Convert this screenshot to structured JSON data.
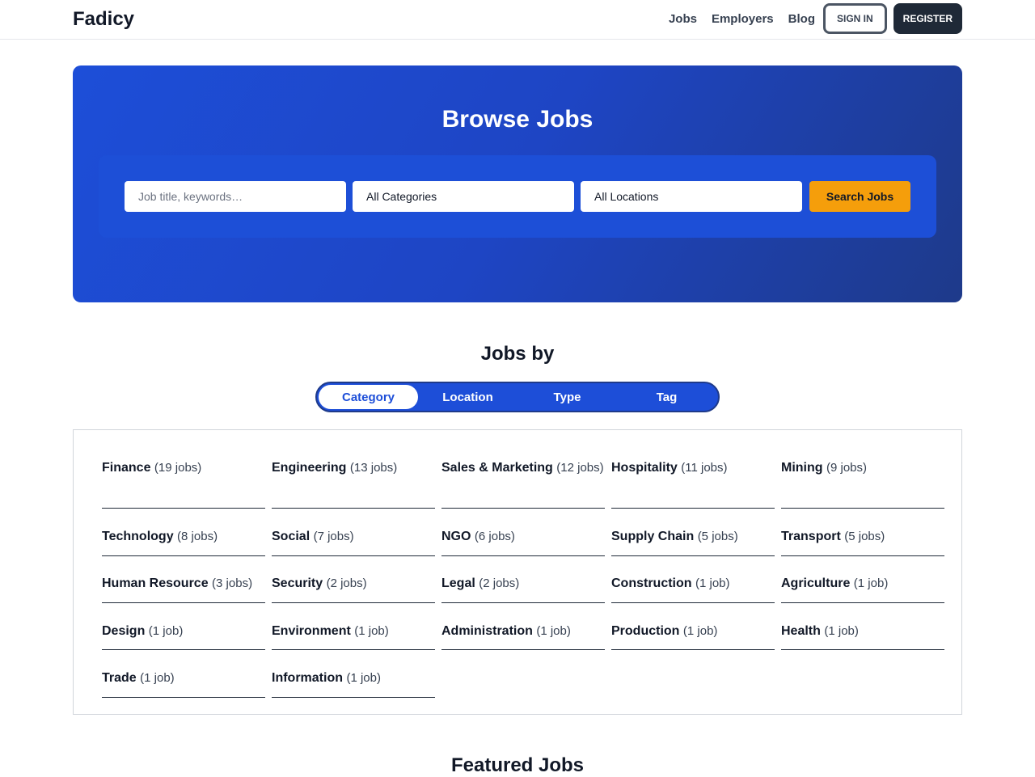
{
  "header": {
    "brand": "Fadicy",
    "nav": [
      "Jobs",
      "Employers",
      "Blog"
    ],
    "sign_in": "SIGN IN",
    "register": "REGISTER"
  },
  "hero": {
    "title": "Browse Jobs",
    "search_placeholder": "Job title, keywords…",
    "category_select": "All Categories",
    "location_select": "All Locations",
    "search_button": "Search Jobs"
  },
  "jobs_by": {
    "title": "Jobs by",
    "tabs": [
      "Category",
      "Location",
      "Type",
      "Tag"
    ],
    "active_tab": "Category",
    "categories": [
      {
        "name": "Finance",
        "count": "(19 jobs)"
      },
      {
        "name": "Engineering",
        "count": "(13 jobs)"
      },
      {
        "name": "Sales & Marketing",
        "count": "(12 jobs)"
      },
      {
        "name": "Hospitality",
        "count": "(11 jobs)"
      },
      {
        "name": "Mining",
        "count": "(9 jobs)"
      },
      {
        "name": "Technology",
        "count": "(8 jobs)"
      },
      {
        "name": "Social",
        "count": "(7 jobs)"
      },
      {
        "name": "NGO",
        "count": "(6 jobs)"
      },
      {
        "name": "Supply Chain",
        "count": "(5 jobs)"
      },
      {
        "name": "Transport",
        "count": "(5 jobs)"
      },
      {
        "name": "Human Resource",
        "count": "(3 jobs)"
      },
      {
        "name": "Security",
        "count": "(2 jobs)"
      },
      {
        "name": "Legal",
        "count": "(2 jobs)"
      },
      {
        "name": "Construction",
        "count": "(1 job)"
      },
      {
        "name": "Agriculture",
        "count": "(1 job)"
      },
      {
        "name": "Design",
        "count": "(1 job)"
      },
      {
        "name": "Environment",
        "count": "(1 job)"
      },
      {
        "name": "Administration",
        "count": "(1 job)"
      },
      {
        "name": "Production",
        "count": "(1 job)"
      },
      {
        "name": "Health",
        "count": "(1 job)"
      },
      {
        "name": "Trade",
        "count": "(1 job)"
      },
      {
        "name": "Information",
        "count": "(1 job)"
      }
    ]
  },
  "featured": {
    "title": "Featured Jobs"
  },
  "colors": {
    "hero_blue": "#1d4ed8",
    "search_button": "#f59e0b",
    "register_button": "#1f2937"
  }
}
